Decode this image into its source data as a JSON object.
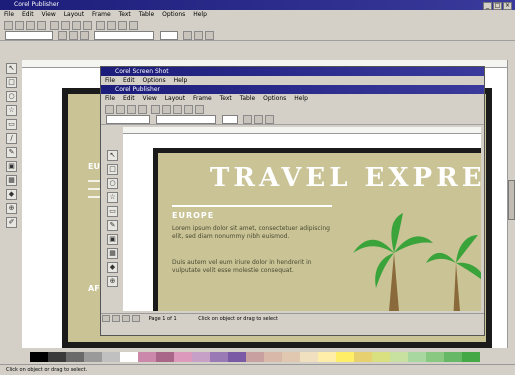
{
  "desktop": {
    "bg": "#5a8fd0"
  },
  "main_window": {
    "title": "Corel Publisher",
    "menu": [
      "File",
      "Edit",
      "View",
      "Layout",
      "Frame",
      "Text",
      "Table",
      "Options",
      "Help"
    ],
    "status": "Click on object or drag to select."
  },
  "inner_window": {
    "title": "Corel Screen Shot",
    "menu": [
      "File",
      "Edit",
      "Options",
      "Help"
    ]
  },
  "doc_window": {
    "title": "Corel Publisher",
    "menu": [
      "File",
      "Edit",
      "View",
      "Layout",
      "Frame",
      "Text",
      "Table",
      "Options",
      "Help"
    ],
    "page_label": "Page 1 of 1",
    "status": "Click on object or drag to select"
  },
  "document": {
    "heading": "TRAVEL EXPRE",
    "section": "EUROPE",
    "para1": "Lorem ipsum dolor sit amet, consectetuer adipiscing elit, sed diam nonummy nibh euismod.",
    "para2": "Duis autem vel eum iriure dolor in hendrerit in vulputate velit esse molestie consequat.",
    "bg_section_1": "EURO",
    "bg_section_2": "AF"
  },
  "colors": {
    "accent_title": "#1c1c7a",
    "page_bg": "#c9c396",
    "palm": "#3aa33a"
  },
  "palette": [
    "#000000",
    "#3a3a3a",
    "#6a6a6a",
    "#9a9a9a",
    "#c0c0c0",
    "#ffffff",
    "#cc88aa",
    "#aa6688",
    "#dd99bb",
    "#c7a0c8",
    "#9a7ab4",
    "#7a5aa4",
    "#c8a0a0",
    "#d8b8a8",
    "#e0c8b0",
    "#f0e0c0",
    "#ffeeaa",
    "#ffee66",
    "#e6d070",
    "#d8e080",
    "#c8e0a0",
    "#a8d8a0",
    "#88c880",
    "#66b866",
    "#44a844"
  ]
}
